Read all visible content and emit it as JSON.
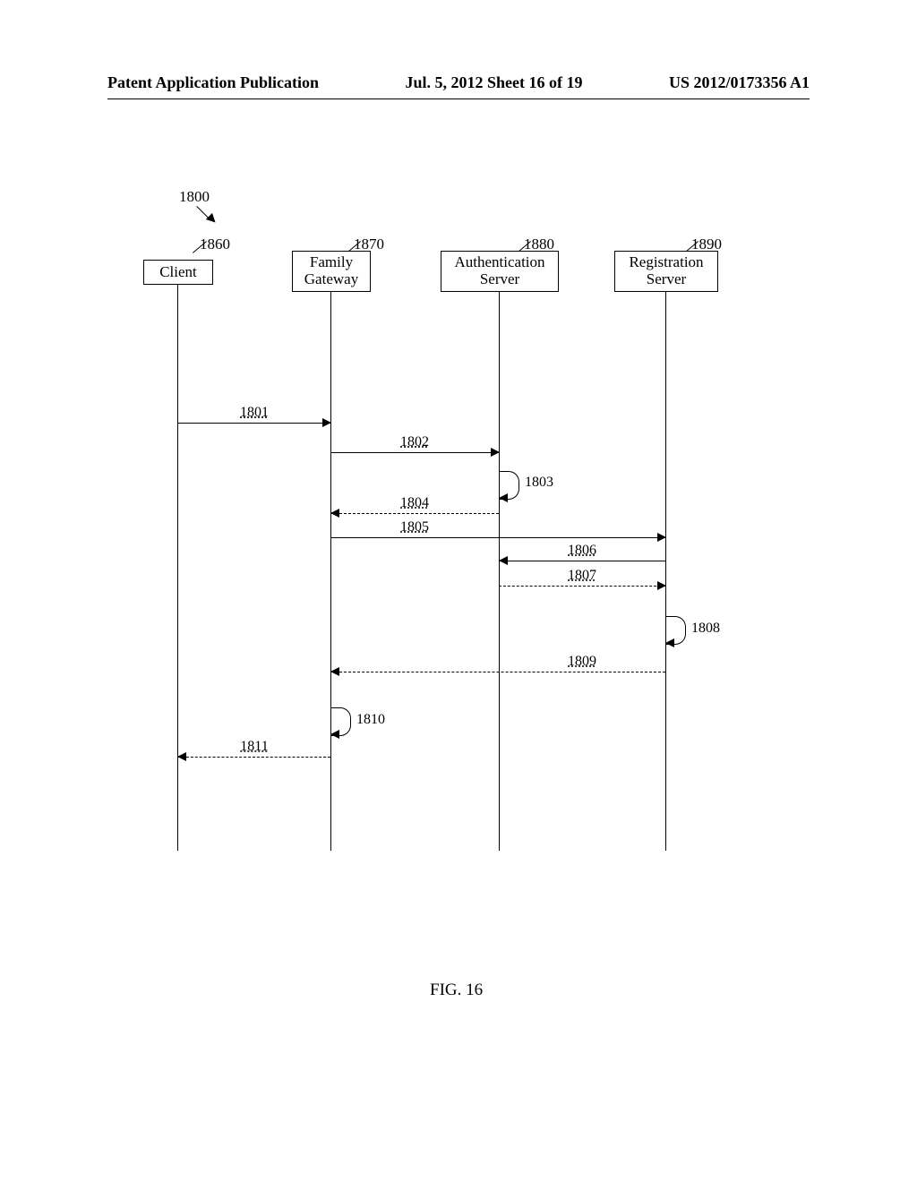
{
  "header": {
    "left": "Patent Application Publication",
    "middle": "Jul. 5, 2012   Sheet 16 of 19",
    "right": "US 2012/0173356 A1"
  },
  "diagram": {
    "title_ref": "1800",
    "actors": {
      "client": {
        "label": "Client",
        "ref": "1860"
      },
      "gateway": {
        "label": "Family\nGateway",
        "ref": "1870"
      },
      "auth": {
        "label": "Authentication\nServer",
        "ref": "1880"
      },
      "reg": {
        "label": "Registration\nServer",
        "ref": "1890"
      }
    },
    "messages": {
      "m1801": {
        "label": "1801"
      },
      "m1802": {
        "label": "1802"
      },
      "m1803": {
        "label": "1803"
      },
      "m1804": {
        "label": "1804"
      },
      "m1805": {
        "label": "1805"
      },
      "m1806": {
        "label": "1806"
      },
      "m1807": {
        "label": "1807"
      },
      "m1808": {
        "label": "1808"
      },
      "m1809": {
        "label": "1809"
      },
      "m1810": {
        "label": "1810"
      },
      "m1811": {
        "label": "1811"
      }
    }
  },
  "caption": "FIG. 16",
  "chart_data": {
    "type": "table",
    "description": "UML-style sequence diagram",
    "reference_number": "1800",
    "lifelines": [
      {
        "id": "client",
        "label": "Client",
        "ref": "1860"
      },
      {
        "id": "gateway",
        "label": "Family Gateway",
        "ref": "1870"
      },
      {
        "id": "auth",
        "label": "Authentication Server",
        "ref": "1880"
      },
      {
        "id": "reg",
        "label": "Registration Server",
        "ref": "1890"
      }
    ],
    "messages": [
      {
        "num": "1801",
        "from": "client",
        "to": "gateway",
        "style": "solid",
        "dir": "right"
      },
      {
        "num": "1802",
        "from": "gateway",
        "to": "auth",
        "style": "solid",
        "dir": "right"
      },
      {
        "num": "1803",
        "from": "auth",
        "to": "auth",
        "style": "solid",
        "dir": "self"
      },
      {
        "num": "1804",
        "from": "auth",
        "to": "gateway",
        "style": "dashed",
        "dir": "left"
      },
      {
        "num": "1805",
        "from": "gateway",
        "to": "reg",
        "style": "solid",
        "dir": "right"
      },
      {
        "num": "1806",
        "from": "reg",
        "to": "auth",
        "style": "solid",
        "dir": "left"
      },
      {
        "num": "1807",
        "from": "auth",
        "to": "reg",
        "style": "dashed",
        "dir": "right"
      },
      {
        "num": "1808",
        "from": "reg",
        "to": "reg",
        "style": "solid",
        "dir": "self"
      },
      {
        "num": "1809",
        "from": "reg",
        "to": "gateway",
        "style": "dashed",
        "dir": "left"
      },
      {
        "num": "1810",
        "from": "gateway",
        "to": "gateway",
        "style": "solid",
        "dir": "self"
      },
      {
        "num": "1811",
        "from": "gateway",
        "to": "client",
        "style": "dashed",
        "dir": "left"
      }
    ]
  }
}
